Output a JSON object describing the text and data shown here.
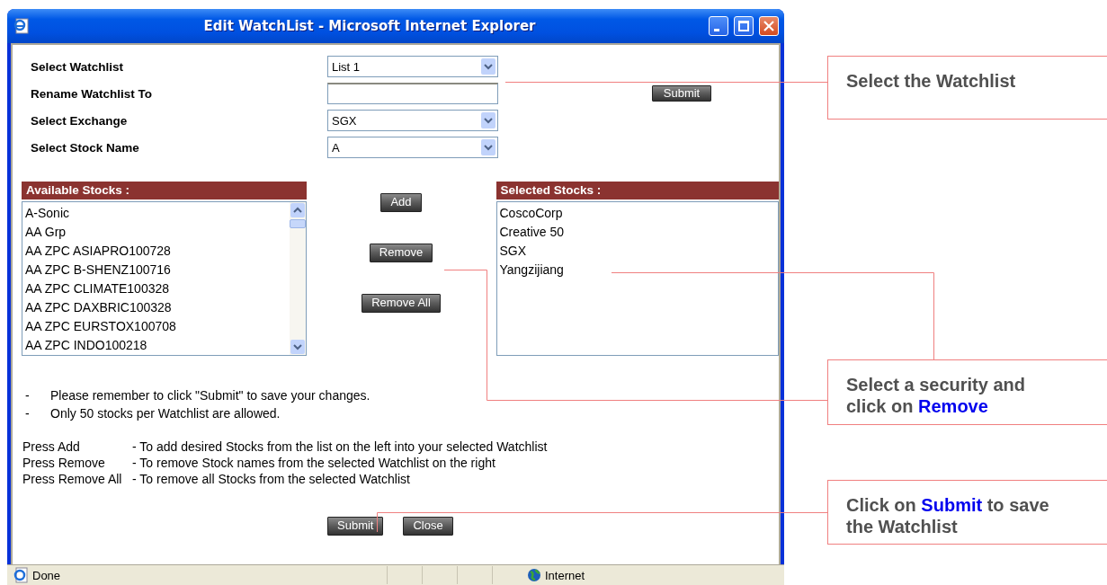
{
  "window": {
    "title": "Edit WatchList - Microsoft Internet Explorer"
  },
  "form": {
    "fields": [
      {
        "label": "Select Watchlist",
        "kind": "select",
        "value": "List 1"
      },
      {
        "label": "Rename Watchlist To",
        "kind": "text"
      },
      {
        "label": "Select Exchange",
        "kind": "select",
        "value": "SGX"
      },
      {
        "label": "Select Stock Name",
        "kind": "select",
        "value": "A"
      }
    ],
    "submit": "Submit"
  },
  "available_stocks": {
    "title": "Available Stocks :",
    "items": [
      "A-Sonic",
      "AA Grp",
      "AA ZPC ASIAPRO100728",
      "AA ZPC B-SHENZ100716",
      "AA ZPC CLIMATE100328",
      "AA ZPC DAXBRIC100328",
      "AA ZPC EURSTOX100708",
      "AA ZPC INDO100218"
    ]
  },
  "move_buttons": [
    "Add",
    "Remove",
    "Remove All"
  ],
  "selected_stocks": {
    "title": "Selected Stocks :",
    "items": [
      "CoscoCorp",
      "Creative 50",
      "SGX",
      "Yangzijiang"
    ]
  },
  "notes": [
    {
      "bullet": "-",
      "text": "Please remember to click \"Submit\" to save your changes."
    },
    {
      "bullet": "-",
      "text": "Only 50 stocks per Watchlist are allowed."
    }
  ],
  "help": [
    {
      "action": "Press Add",
      "description": "- To add desired Stocks from the list on the left into your selected Watchlist"
    },
    {
      "action": "Press Remove",
      "description": "- To remove Stock names from the selected Watchlist on the right"
    },
    {
      "action": "Press Remove All",
      "description": "- To remove all Stocks from the selected Watchlist"
    }
  ],
  "buttons": [
    "Submit",
    "Close"
  ],
  "status_bar": {
    "text": "Done",
    "zone": "Internet"
  },
  "callouts": [
    {
      "text": "Select the Watchlist"
    },
    {
      "text": "Select a security  and click on **Remove**"
    },
    {
      "text": "Click on **Submit** to save the Watchlist"
    }
  ]
}
